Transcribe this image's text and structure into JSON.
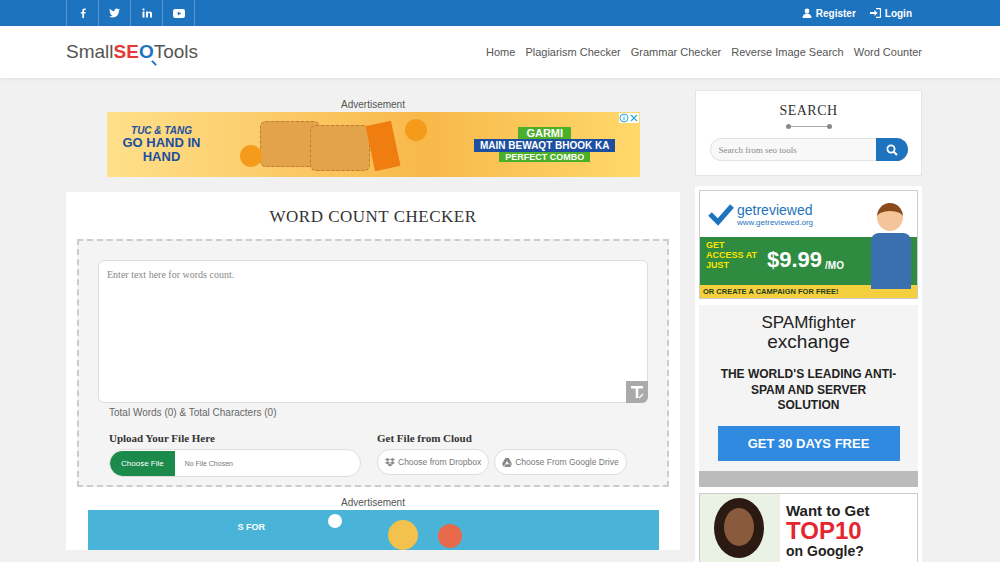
{
  "top_bar": {
    "auth": [
      {
        "label": "Register"
      },
      {
        "label": "Login"
      }
    ]
  },
  "logo": [
    "Small",
    "SE",
    "O",
    "Tools"
  ],
  "nav": [
    "Home",
    "Plagiarism Checker",
    "Grammar Checker",
    "Reverse Image Search",
    "Word Counter"
  ],
  "ad_label": "Advertisement",
  "top_ad": {
    "brand": "TUC & TANG",
    "slogan": "GO HAND IN HAND",
    "headline": "GARMI",
    "sub": "MAIN BEWAQT BHOOK KA",
    "tag": "PERFECT COMBO"
  },
  "tool": {
    "title": "WORD COUNT CHECKER",
    "placeholder": "Enter text here for words count.",
    "counts": "Total Words (0) & Total Characters (0)",
    "upload": {
      "heading": "Upload Your File Here",
      "button": "Choose File",
      "status": "No File Chosen"
    },
    "cloud": {
      "heading": "Get File from Cloud",
      "buttons": [
        "Choose from Dropbox",
        "Choose From Google Drive"
      ]
    }
  },
  "bottom_ad": {
    "text": "S FOR"
  },
  "search": {
    "title": "SEARCH",
    "placeholder": "Search from seo tools"
  },
  "side_ads": {
    "getreviewed": {
      "brand": "getreviewed",
      "url": "www.getreviewed.org",
      "lead": "GET ACCESS AT JUST",
      "price": "$9.99",
      "per": "/MO",
      "strip": "OR CREATE A CAMPAIGN FOR FREE!"
    },
    "spam": {
      "brand": "SPAMfighter",
      "sub": "exchange",
      "body": "THE WORLD'S LEADING ANTI-SPAM AND SERVER SOLUTION",
      "button": "GET 30 DAYS FREE"
    },
    "top10": {
      "line1": "Want to Get",
      "line2": "TOP10",
      "line3": "on Google?"
    }
  }
}
